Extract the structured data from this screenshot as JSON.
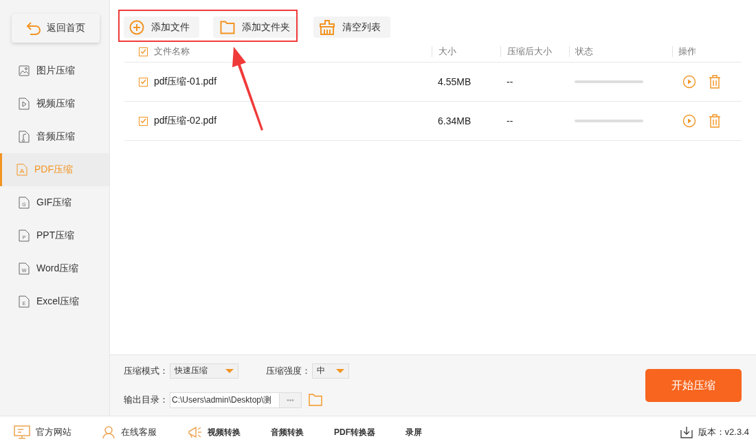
{
  "sidebar": {
    "back_button": "返回首页",
    "items": [
      {
        "label": "图片压缩",
        "kind": "image",
        "selected": false
      },
      {
        "label": "视频压缩",
        "kind": "video",
        "selected": false
      },
      {
        "label": "音频压缩",
        "kind": "audio",
        "selected": false
      },
      {
        "label": "PDF压缩",
        "kind": "pdf",
        "selected": true
      },
      {
        "label": "GIF压缩",
        "kind": "doc",
        "icon_letter": "G",
        "selected": false
      },
      {
        "label": "PPT压缩",
        "kind": "doc",
        "icon_letter": "P",
        "selected": false
      },
      {
        "label": "Word压缩",
        "kind": "doc",
        "icon_letter": "W",
        "selected": false
      },
      {
        "label": "Excel压缩",
        "kind": "doc",
        "icon_letter": "E",
        "selected": false
      }
    ]
  },
  "toolbar": [
    {
      "label": "添加文件",
      "kind": "add"
    },
    {
      "label": "添加文件夹",
      "kind": "folder"
    },
    {
      "label": "清空列表",
      "kind": "clear"
    }
  ],
  "table": {
    "header_checked": true,
    "columns": [
      "文件名称",
      "大小",
      "压缩后大小",
      "状态",
      "操作"
    ],
    "rows": [
      {
        "checked": true,
        "name": "pdf压缩-01.pdf",
        "size": "4.55MB",
        "compressed_size": "--",
        "level": 0
      },
      {
        "checked": true,
        "name": "pdf压缩-02.pdf",
        "size": "6.34MB",
        "compressed_size": "--",
        "level": 0
      }
    ]
  },
  "settings": {
    "mode_label": "压缩模式：",
    "mode_value": "快速压缩",
    "strength_label": "压缩强度：",
    "strength_value": "中",
    "output_label": "输出目录：",
    "output_path": "C:\\Users\\admin\\Desktop\\测",
    "browse": "•••",
    "start_button": "开始压缩"
  },
  "footer": {
    "links": [
      {
        "label": "官方网站",
        "kind": "monitor"
      },
      {
        "label": "在线客服",
        "kind": "person"
      },
      {
        "label": "视频转换",
        "kind": "promo"
      },
      {
        "label": "音频转换",
        "kind": "plain"
      },
      {
        "label": "PDF转换器",
        "kind": "plain"
      },
      {
        "label": "录屏",
        "kind": "plain"
      }
    ],
    "version": "版本：v2.3.4"
  }
}
